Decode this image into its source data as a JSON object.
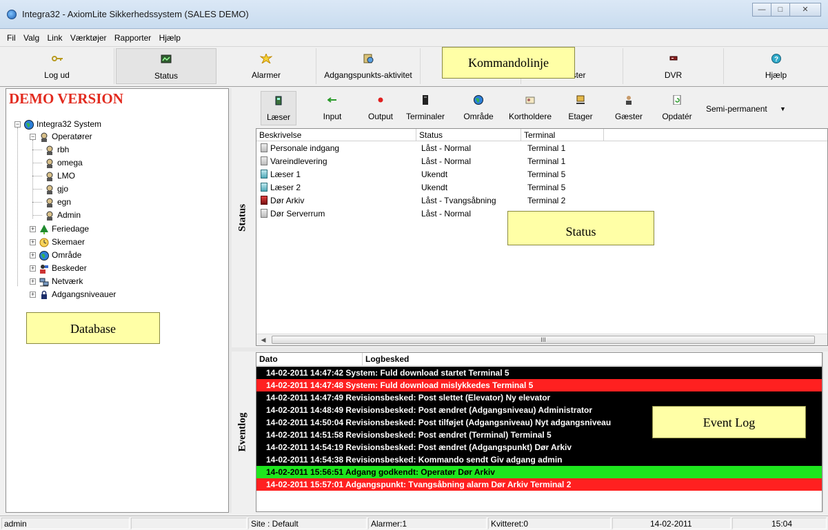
{
  "window": {
    "title": "Integra32 - AxiomLite Sikkerhedssystem (SALES DEMO)",
    "controls": [
      "minimize",
      "maximize",
      "close"
    ]
  },
  "menu": [
    "Fil",
    "Valg",
    "Link",
    "Værktøjer",
    "Rapporter",
    "Hjælp"
  ],
  "toolbar": [
    {
      "label": "Log ud",
      "icon": "key-icon"
    },
    {
      "label": "Status",
      "icon": "monitor-icon",
      "active": true
    },
    {
      "label": "Alarmer",
      "icon": "alarm-burst-icon"
    },
    {
      "label": "Adgangspunkts-aktivitet",
      "icon": "access-activity-icon"
    },
    {
      "label": "",
      "icon": "hidden-icon"
    },
    {
      "label": "ster",
      "icon": "person-icon"
    },
    {
      "label": "DVR",
      "icon": "dvr-icon"
    },
    {
      "label": "Hjælp",
      "icon": "help-icon"
    }
  ],
  "callouts": {
    "kommandolinje": "Kommandolinje",
    "database": "Database",
    "status": "Status",
    "eventlog": "Event Log"
  },
  "left_panel": {
    "demo_label": "DEMO VERSION",
    "tree": {
      "root": "Integra32 System",
      "operators_label": "Operatører",
      "operators": [
        "rbh",
        "omega",
        "LMO",
        "gjo",
        "egn",
        "Admin"
      ],
      "groups": [
        "Feriedage",
        "Skemaer",
        "Område",
        "Beskeder",
        "Netværk",
        "Adgangsniveauer"
      ]
    }
  },
  "side_labels": {
    "status": "Status",
    "eventlog": "Eventlog"
  },
  "sub_toolbar": {
    "buttons": [
      {
        "label": "Læser",
        "icon": "reader-icon",
        "active": true
      },
      {
        "label": "Input",
        "icon": "input-icon"
      },
      {
        "label": "Output",
        "icon": "output-icon"
      },
      {
        "label": "Terminaler",
        "icon": "terminal-icon"
      },
      {
        "label": "Område",
        "icon": "globe-icon"
      },
      {
        "label": "Kortholdere",
        "icon": "cardholder-icon"
      },
      {
        "label": "Etager",
        "icon": "floors-icon"
      },
      {
        "label": "Gæster",
        "icon": "guest-icon"
      },
      {
        "label": "Opdatér",
        "icon": "refresh-icon"
      }
    ],
    "mode_select": "Semi-permanent"
  },
  "status_list": {
    "columns": [
      "Beskrivelse",
      "Status",
      "Terminal"
    ],
    "rows": [
      {
        "icon": "door-gray",
        "desc": "Personale indgang",
        "status": "Låst - Normal",
        "terminal": "Terminal 1"
      },
      {
        "icon": "door-gray",
        "desc": "Vareindlevering",
        "status": "Låst - Normal",
        "terminal": "Terminal 1"
      },
      {
        "icon": "door-teal",
        "desc": "Læser 1",
        "status": "Ukendt",
        "terminal": "Terminal 5"
      },
      {
        "icon": "door-teal",
        "desc": "Læser 2",
        "status": "Ukendt",
        "terminal": "Terminal 5"
      },
      {
        "icon": "door-alarm",
        "desc": "Dør Arkiv",
        "status": "Låst - Tvangsåbning",
        "terminal": "Terminal 2"
      },
      {
        "icon": "door-gray",
        "desc": "Dør Serverrum",
        "status": "Låst - Normal",
        "terminal": ""
      }
    ],
    "scroll_thumb": "III"
  },
  "event_log": {
    "columns": [
      "Dato",
      "Logbesked"
    ],
    "rows": [
      {
        "text": "14-02-2011 14:47:42  System: Fuld download startet  Terminal 5",
        "bg": "#000000",
        "fg": "#ffffff"
      },
      {
        "text": "14-02-2011 14:47:48  System: Fuld download mislykkedes  Terminal 5",
        "bg": "#ff2020",
        "fg": "#ffffff"
      },
      {
        "text": "14-02-2011 14:47:49  Revisionsbesked: Post slettet (Elevator) Ny elevator",
        "bg": "#000000",
        "fg": "#ffffff"
      },
      {
        "text": "14-02-2011 14:48:49  Revisionsbesked: Post ændret (Adgangsniveau) Administrator",
        "bg": "#000000",
        "fg": "#ffffff"
      },
      {
        "text": "14-02-2011 14:50:04  Revisionsbesked: Post tilføjet (Adgangsniveau) Nyt adgangsniveau",
        "bg": "#000000",
        "fg": "#ffffff"
      },
      {
        "text": "14-02-2011 14:51:58  Revisionsbesked: Post ændret (Terminal) Terminal 5",
        "bg": "#000000",
        "fg": "#ffffff"
      },
      {
        "text": "14-02-2011 14:54:19  Revisionsbesked: Post ændret (Adgangspunkt) Dør Arkiv",
        "bg": "#000000",
        "fg": "#ffffff"
      },
      {
        "text": "14-02-2011 14:54:38  Revisionsbesked: Kommando sendt Giv adgang  admin",
        "bg": "#000000",
        "fg": "#ffffff"
      },
      {
        "text": "14-02-2011 15:56:51  Adgang godkendt: Operatør Dør Arkiv",
        "bg": "#1ee61e",
        "fg": "#000000"
      },
      {
        "text": "14-02-2011 15:57:01  Adgangspunkt: Tvangsåbning alarm Dør Arkiv Terminal 2",
        "bg": "#ff2020",
        "fg": "#ffffff"
      }
    ]
  },
  "statusbar": {
    "user": "admin",
    "blank": "",
    "site": "Site : Default",
    "alarms": "Alarmer:1",
    "acknowledged": "Kvitteret:0",
    "date": "14-02-2011",
    "time": "15:04"
  }
}
